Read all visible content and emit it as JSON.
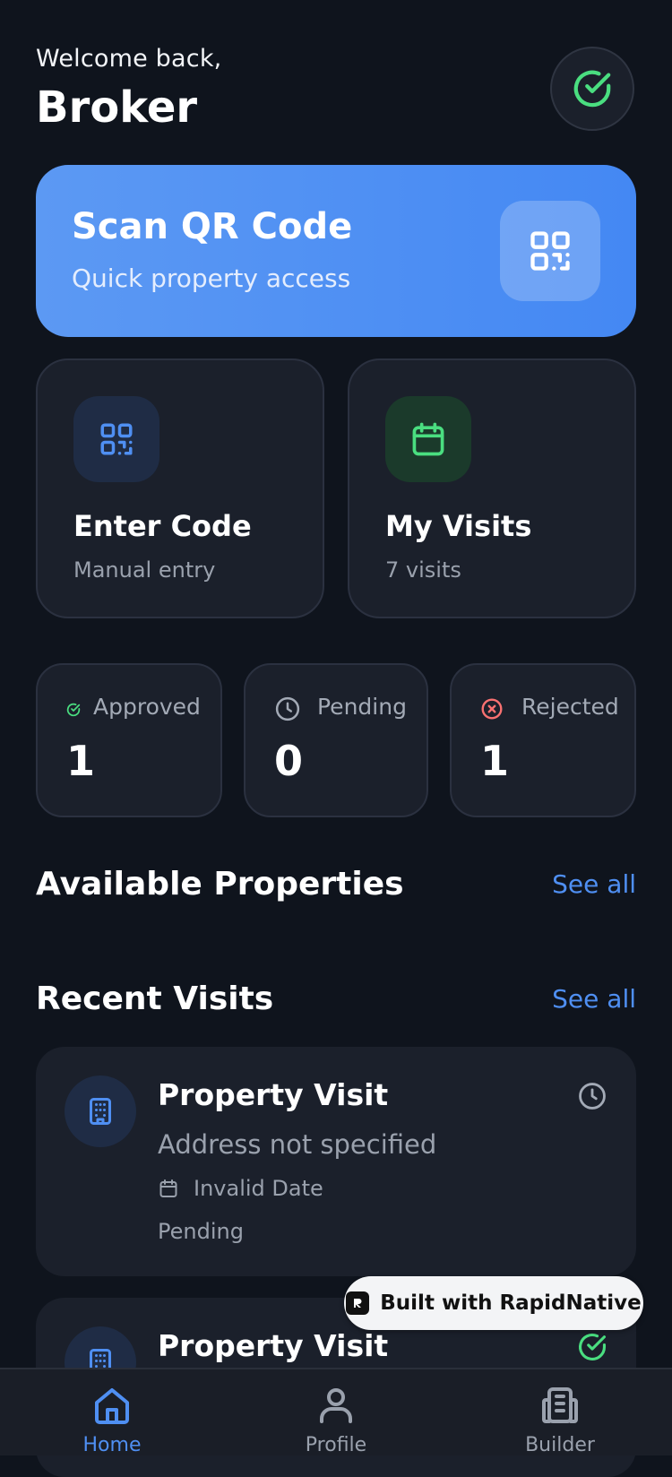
{
  "header": {
    "welcome": "Welcome back,",
    "name": "Broker",
    "status_icon": "check-circle-icon"
  },
  "scan_card": {
    "title": "Scan QR Code",
    "subtitle": "Quick property access",
    "icon": "qr-code-icon"
  },
  "actions": [
    {
      "title": "Enter Code",
      "subtitle": "Manual entry",
      "icon": "qr-code-icon"
    },
    {
      "title": "My Visits",
      "subtitle": "7 visits",
      "icon": "calendar-icon"
    }
  ],
  "stats": [
    {
      "label": "Approved",
      "value": "1",
      "icon": "check-circle-icon"
    },
    {
      "label": "Pending",
      "value": "0",
      "icon": "clock-icon"
    },
    {
      "label": "Rejected",
      "value": "1",
      "icon": "x-circle-icon"
    }
  ],
  "available": {
    "title": "Available Properties",
    "see_all": "See all"
  },
  "recent": {
    "title": "Recent Visits",
    "see_all": "See all"
  },
  "visits": [
    {
      "title": "Property Visit",
      "address": "Address not specified",
      "date": "Invalid Date",
      "status": "Pending",
      "status_icon": "clock-icon"
    },
    {
      "title": "Property Visit",
      "status_icon": "check-circle-icon"
    }
  ],
  "badge": {
    "text": "Built with RapidNative"
  },
  "nav": [
    {
      "label": "Home",
      "icon": "home-icon",
      "active": true
    },
    {
      "label": "Profile",
      "icon": "user-icon",
      "active": false
    },
    {
      "label": "Builder",
      "icon": "building-icon",
      "active": false
    }
  ],
  "colors": {
    "background": "#0f141d",
    "card": "#1b202b",
    "accent": "#4f8ff2",
    "success": "#4ade80",
    "danger": "#f87171"
  }
}
